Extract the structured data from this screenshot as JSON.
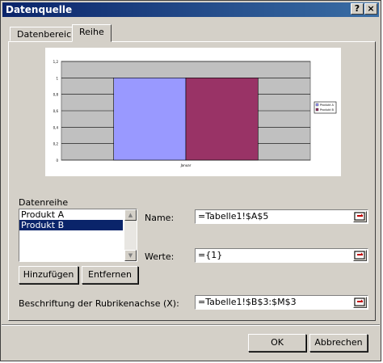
{
  "window": {
    "title": "Datenquelle",
    "help_label": "?",
    "close_label": "×"
  },
  "tabs": [
    {
      "label": "Datenbereich"
    },
    {
      "label": "Reihe"
    }
  ],
  "preview_chart": {
    "axis_ticks": [
      "1,2",
      "1",
      "0,8",
      "0,6",
      "0,4",
      "0,2",
      "0"
    ],
    "legend": [
      "Produkt A",
      "Produkt B"
    ],
    "xlabel": "Januar",
    "colors": {
      "series_a": "#9999ff",
      "series_b": "#993366",
      "plot_bg": "#c0c0c0"
    }
  },
  "chart_data": {
    "type": "bar",
    "categories": [
      "Januar"
    ],
    "series": [
      {
        "name": "Produkt A",
        "values": [
          1
        ]
      },
      {
        "name": "Produkt B",
        "values": [
          1
        ]
      }
    ],
    "ylim": [
      0,
      1.2
    ],
    "grid": true,
    "legend_position": "right"
  },
  "series_panel": {
    "group_label": "Datenreihe",
    "items": [
      {
        "label": "Produkt A",
        "selected": false
      },
      {
        "label": "Produkt B",
        "selected": true
      }
    ],
    "add_label": "Hinzufügen",
    "remove_label": "Entfernen"
  },
  "fields": {
    "name": {
      "label": "Name:",
      "value": "=Tabelle1!$A$5"
    },
    "werte": {
      "label": "Werte:",
      "value": "={1}"
    },
    "category": {
      "label": "Beschriftung der Rubrikenachse (X):",
      "value": "=Tabelle1!$B$3:$M$3"
    }
  },
  "footer": {
    "ok_label": "OK",
    "cancel_label": "Abbrechen"
  }
}
